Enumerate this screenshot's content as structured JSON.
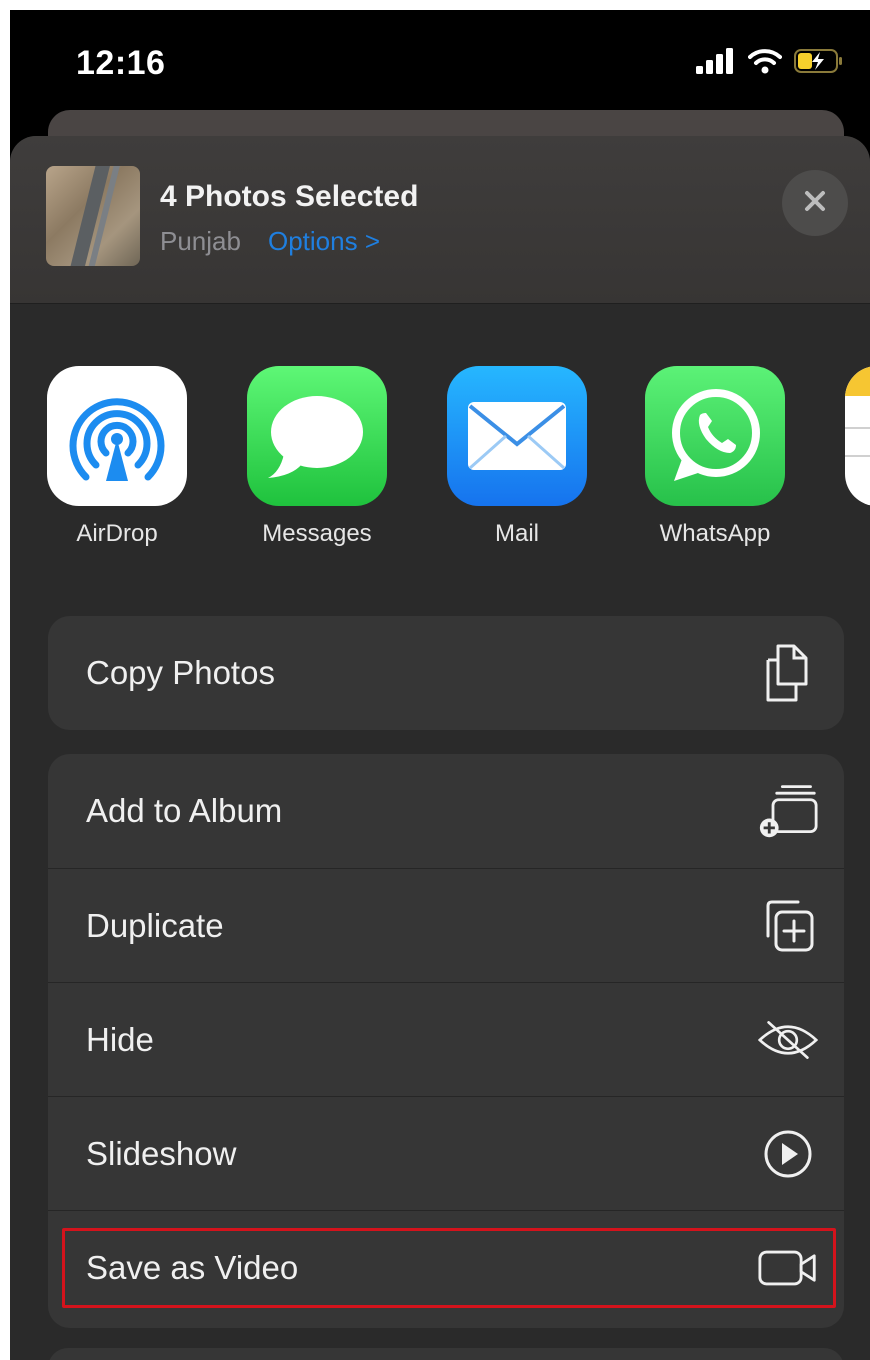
{
  "status_bar": {
    "time": "12:16",
    "icons": [
      "cellular-signal-icon",
      "wifi-icon",
      "battery-charging-icon"
    ],
    "battery_color": "#f7d02c"
  },
  "share_sheet": {
    "title": "4 Photos Selected",
    "subtitle": "Punjab",
    "options_label": "Options >",
    "accent_color": "#1f7fe0",
    "close_icon": "close-icon"
  },
  "apps": [
    {
      "label": "AirDrop",
      "icon": "airdrop-icon"
    },
    {
      "label": "Messages",
      "icon": "messages-icon"
    },
    {
      "label": "Mail",
      "icon": "mail-icon"
    },
    {
      "label": "WhatsApp",
      "icon": "whatsapp-icon"
    },
    {
      "label": "",
      "icon": "notes-icon"
    }
  ],
  "actions_group_1": [
    {
      "label": "Copy Photos",
      "icon": "copy-icon"
    }
  ],
  "actions_group_2": [
    {
      "label": "Add to Album",
      "icon": "add-to-album-icon"
    },
    {
      "label": "Duplicate",
      "icon": "duplicate-icon"
    },
    {
      "label": "Hide",
      "icon": "hide-eye-icon"
    },
    {
      "label": "Slideshow",
      "icon": "play-circle-icon"
    },
    {
      "label": "Save as Video",
      "icon": "video-camera-icon",
      "highlighted": true
    }
  ],
  "highlight_color": "#d4131c"
}
